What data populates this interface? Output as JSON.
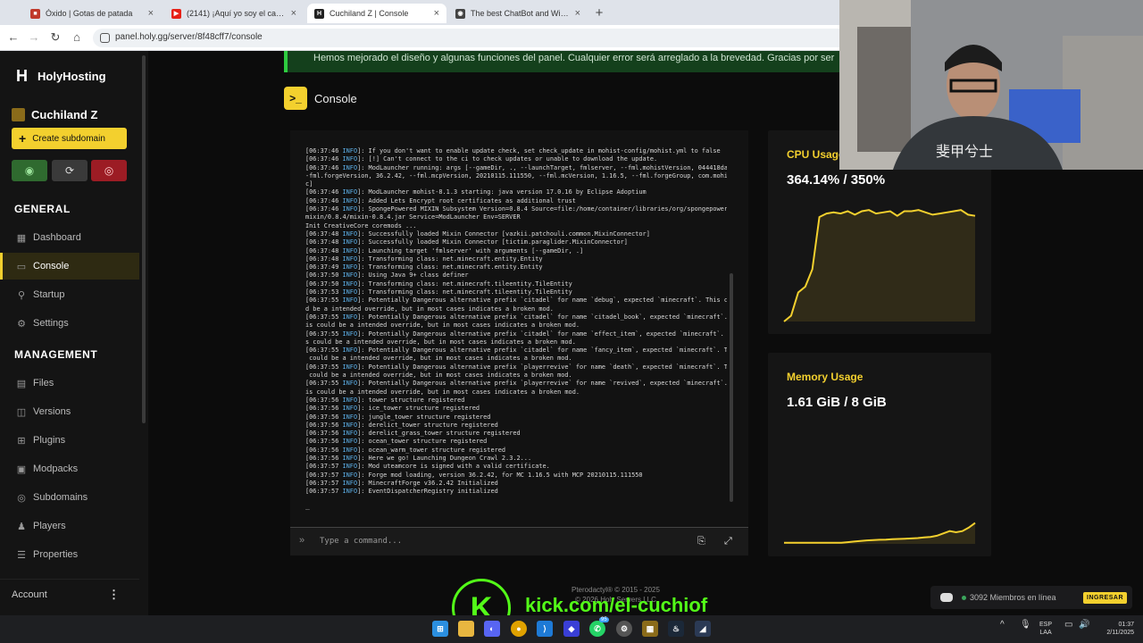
{
  "browser": {
    "tabs": [
      {
        "title": "Óxido | Gotas de patada",
        "color": "#c0392b",
        "icon_glyph": "■"
      },
      {
        "title": "(2141) ¡Aquí yo soy el campeó",
        "color": "#e62117",
        "icon_glyph": "▶"
      },
      {
        "title": "Cuchiland Z | Console",
        "color": "#222222",
        "icon_glyph": "H"
      },
      {
        "title": "The best ChatBot and Widgets",
        "color": "#444444",
        "icon_glyph": "◉"
      }
    ],
    "url": "panel.holy.gg/server/8f48cff7/console"
  },
  "sidebar": {
    "brand": "HolyHosting",
    "server_name": "Cuchiland Z",
    "create_subdomain": "Create subdomain",
    "power": {
      "start_color": "#2f6a2f",
      "restart_color": "#3a3a3a",
      "stop_color": "#9c1c24"
    },
    "sections": {
      "general": "GENERAL",
      "management": "MANAGEMENT"
    },
    "general_items": [
      {
        "label": "Dashboard",
        "icon": "dashboard-icon",
        "glyph": "▦"
      },
      {
        "label": "Console",
        "icon": "console-icon",
        "glyph": "▭"
      },
      {
        "label": "Startup",
        "icon": "startup-icon",
        "glyph": "⚲"
      },
      {
        "label": "Settings",
        "icon": "settings-icon",
        "glyph": "⚙"
      }
    ],
    "management_items": [
      {
        "label": "Files",
        "icon": "files-icon",
        "glyph": "▤"
      },
      {
        "label": "Versions",
        "icon": "versions-icon",
        "glyph": "◫"
      },
      {
        "label": "Plugins",
        "icon": "plugins-icon",
        "glyph": "⊞"
      },
      {
        "label": "Modpacks",
        "icon": "modpacks-icon",
        "glyph": "▣"
      },
      {
        "label": "Subdomains",
        "icon": "subdomains-icon",
        "glyph": "◎"
      },
      {
        "label": "Players",
        "icon": "players-icon",
        "glyph": "♟"
      },
      {
        "label": "Properties",
        "icon": "properties-icon",
        "glyph": "☰"
      }
    ],
    "account": "Account"
  },
  "banner": "Hemos mejorado el diseño y algunas funciones del panel. Cualquier error será arreglado a la brevedad. Gracias por ser",
  "page_title": "Console",
  "console": {
    "lines": [
      [
        "[06:37:46 ",
        "INFO",
        "]: If you don't want to enable update check, set check_update in mohist-config/mohist.yml to false"
      ],
      [
        "[06:37:46 ",
        "INFO",
        "]: [!] Can't connect to the ci to check updates or unable to download the update."
      ],
      [
        "[06:37:46 ",
        "INFO",
        "]: ModLauncher running: args [--gameDir, ., --launchTarget, fmlserver, --fml.mohistVersion, 044418da, -"
      ],
      [
        "",
        "",
        "-fml.forgeVersion, 36.2.42, --fml.mcpVersion, 20210115.111550, --fml.mcVersion, 1.16.5, --fml.forgeGroup, com.mohistm"
      ],
      [
        "",
        "",
        "c]"
      ],
      [
        "[06:37:46 ",
        "INFO",
        "]: ModLauncher mohist-8.1.3 starting: java version 17.0.16 by Eclipse Adoptium"
      ],
      [
        "[06:37:46 ",
        "INFO",
        "]: Added Lets Encrypt root certificates as additional trust"
      ],
      [
        "[06:37:46 ",
        "INFO",
        "]: SpongePowered MIXIN Subsystem Version=0.8.4 Source=file:/home/container/libraries/org/spongepowered/"
      ],
      [
        "",
        "",
        "mixin/0.8.4/mixin-0.8.4.jar Service=ModLauncher Env=SERVER"
      ],
      [
        "",
        "",
        "Init CreativeCore coremods ..."
      ],
      [
        "[06:37:48 ",
        "INFO",
        "]: Successfully loaded Mixin Connector [vazkii.patchouli.common.MixinConnector]"
      ],
      [
        "[06:37:48 ",
        "INFO",
        "]: Successfully loaded Mixin Connector [tictim.paraglider.MixinConnector]"
      ],
      [
        "[06:37:48 ",
        "INFO",
        "]: Launching target 'fmlserver' with arguments [--gameDir, .]"
      ],
      [
        "[06:37:48 ",
        "INFO",
        "]: Transforming class: net.minecraft.entity.Entity"
      ],
      [
        "[06:37:49 ",
        "INFO",
        "]: Transforming class: net.minecraft.entity.Entity"
      ],
      [
        "[06:37:50 ",
        "INFO",
        "]: Using Java 9+ class definer"
      ],
      [
        "[06:37:50 ",
        "INFO",
        "]: Transforming class: net.minecraft.tileentity.TileEntity"
      ],
      [
        "[06:37:53 ",
        "INFO",
        "]: Transforming class: net.minecraft.tileentity.TileEntity"
      ],
      [
        "[06:37:55 ",
        "INFO",
        "]: Potentially Dangerous alternative prefix `citadel` for name `debug`, expected `minecraft`. This coul"
      ],
      [
        "",
        "",
        "d be a intended override, but in most cases indicates a broken mod."
      ],
      [
        "[06:37:55 ",
        "INFO",
        "]: Potentially Dangerous alternative prefix `citadel` for name `citadel_book`, expected `minecraft`. Th"
      ],
      [
        "",
        "",
        "is could be a intended override, but in most cases indicates a broken mod."
      ],
      [
        "[06:37:55 ",
        "INFO",
        "]: Potentially Dangerous alternative prefix `citadel` for name `effect_item`, expected `minecraft`. Thi"
      ],
      [
        "",
        "",
        "s could be a intended override, but in most cases indicates a broken mod."
      ],
      [
        "[06:37:55 ",
        "INFO",
        "]: Potentially Dangerous alternative prefix `citadel` for name `fancy_item`, expected `minecraft`. This"
      ],
      [
        "",
        "",
        " could be a intended override, but in most cases indicates a broken mod."
      ],
      [
        "[06:37:55 ",
        "INFO",
        "]: Potentially Dangerous alternative prefix `playerrevive` for name `death`, expected `minecraft`. This"
      ],
      [
        "",
        "",
        " could be a intended override, but in most cases indicates a broken mod."
      ],
      [
        "[06:37:55 ",
        "INFO",
        "]: Potentially Dangerous alternative prefix `playerrevive` for name `revived`, expected `minecraft`. Th"
      ],
      [
        "",
        "",
        "is could be a intended override, but in most cases indicates a broken mod."
      ],
      [
        "[06:37:56 ",
        "INFO",
        "]: tower structure registered"
      ],
      [
        "[06:37:56 ",
        "INFO",
        "]: ice_tower structure registered"
      ],
      [
        "[06:37:56 ",
        "INFO",
        "]: jungle_tower structure registered"
      ],
      [
        "[06:37:56 ",
        "INFO",
        "]: derelict_tower structure registered"
      ],
      [
        "[06:37:56 ",
        "INFO",
        "]: derelict_grass_tower structure registered"
      ],
      [
        "[06:37:56 ",
        "INFO",
        "]: ocean_tower structure registered"
      ],
      [
        "[06:37:56 ",
        "INFO",
        "]: ocean_warm_tower structure registered"
      ],
      [
        "[06:37:56 ",
        "INFO",
        "]: Here we go! Launching Dungeon Crawl 2.3.2..."
      ],
      [
        "[06:37:57 ",
        "INFO",
        "]: Mod uteamcore is signed with a valid certificate."
      ],
      [
        "[06:37:57 ",
        "INFO",
        "]: Forge mod loading, version 36.2.42, for MC 1.16.5 with MCP 20210115.111550"
      ],
      [
        "[06:37:57 ",
        "INFO",
        "]: MinecraftForge v36.2.42 Initialized"
      ],
      [
        "[06:37:57 ",
        "INFO",
        "]: EventDispatcherRegistry initialized"
      ]
    ],
    "cursor": "_",
    "command_placeholder": "Type a command..."
  },
  "cpu": {
    "label": "CPU Usage",
    "value": "364.14% / 350%",
    "color": "#f3d02e"
  },
  "memory": {
    "label": "Memory Usage",
    "value": "1.61 GiB / 8 GiB",
    "color": "#f3d02e"
  },
  "chart_data": [
    {
      "type": "area",
      "title": "CPU Usage",
      "values": [
        0,
        5,
        25,
        30,
        45,
        90,
        93,
        94,
        93,
        95,
        92,
        95,
        96,
        93,
        94,
        95,
        91,
        95,
        95,
        96,
        94,
        92,
        93,
        94,
        95,
        96,
        92,
        91
      ],
      "ylim": [
        0,
        100
      ]
    },
    {
      "type": "area",
      "title": "Memory Usage",
      "values": [
        1,
        1,
        1,
        1,
        1,
        1,
        1,
        1,
        1,
        1,
        1.5,
        2,
        2.5,
        3,
        3.3,
        3.5,
        3.7,
        4,
        4.2,
        4.5,
        4.7,
        5,
        5.5,
        6,
        7,
        9,
        11,
        10,
        11,
        14,
        18
      ],
      "ylim": [
        0,
        100
      ]
    }
  ],
  "discord": {
    "members": "3092 Miembros en línea",
    "join": "INGRESAR"
  },
  "footer": {
    "line1": "Pterodactyl® © 2015 - 2025",
    "line2": "© 2026 Holy Servers LLC"
  },
  "overlay": {
    "kick_letter": "K",
    "kick_url": "kick.com/el-cuchiof"
  },
  "taskbar": {
    "lang1": "ESP",
    "lang2": "LAA",
    "time": "01:37",
    "date": "2/11/2025",
    "badge": "95"
  }
}
